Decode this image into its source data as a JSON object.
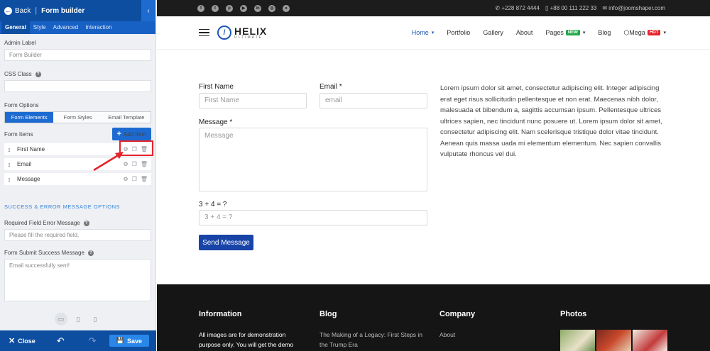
{
  "panel": {
    "back_label": "Back",
    "title": "Form builder",
    "tabs": [
      "General",
      "Style",
      "Advanced",
      "Interaction"
    ],
    "admin_label": {
      "label": "Admin Label",
      "value": "Form Builder"
    },
    "css_class": {
      "label": "CSS Class",
      "value": ""
    },
    "form_options": {
      "label": "Form Options",
      "segments": [
        "Form Elements",
        "Form Styles",
        "Email Template"
      ],
      "active": 0
    },
    "form_items": {
      "label": "Form Items",
      "add_label": "Add Item",
      "items": [
        {
          "label": "First Name"
        },
        {
          "label": "Email"
        },
        {
          "label": "Message"
        }
      ]
    },
    "section_title": "SUCCESS & ERROR MESSAGE OPTIONS",
    "required_error": {
      "label": "Required Field Error Message",
      "value": "Please fill the required field."
    },
    "success_message": {
      "label": "Form Submit Success Message",
      "value": "Email successfully sent!"
    },
    "footer": {
      "close_label": "Close",
      "save_label": "Save"
    },
    "colors": {
      "primary": "#0d4ea0",
      "accent": "#1d6bd1",
      "highlight": "#e5232a"
    }
  },
  "site": {
    "topbar": {
      "socials": [
        "facebook-icon",
        "twitter-icon",
        "pinterest-icon",
        "youtube-icon",
        "linkedin-icon",
        "instagram-icon",
        "flickr-icon"
      ],
      "phone": "+228 872 4444",
      "mobile": "+88 00 111 222 33",
      "email": "info@joomshaper.com"
    },
    "logo": {
      "name": "HELIX",
      "tagline": "ULTIMATE"
    },
    "nav": [
      {
        "label": "Home",
        "active": true,
        "caret": true
      },
      {
        "label": "Portfolio"
      },
      {
        "label": "Gallery"
      },
      {
        "label": "About"
      },
      {
        "label": "Pages",
        "badge": "NEW",
        "caret": true
      },
      {
        "label": "Blog"
      },
      {
        "label": "Mega",
        "badge": "HOT",
        "caret": true
      }
    ],
    "form": {
      "first_name": {
        "label": "First Name",
        "placeholder": "First Name"
      },
      "email": {
        "label": "Email *",
        "placeholder": "email"
      },
      "message": {
        "label": "Message *",
        "placeholder": "Message"
      },
      "captcha": {
        "label": "3 + 4 = ?",
        "placeholder": "3 + 4 = ?"
      },
      "submit": "Send Message"
    },
    "lorem": "Lorem ipsum dolor sit amet, consectetur adipiscing elit. Integer adipiscing erat eget risus sollicitudin pellentesque et non erat. Maecenas nibh dolor, malesuada et bibendum a, sagittis accumsan ipsum. Pellentesque ultrices ultrices sapien, nec tincidunt nunc posuere ut. Lorem ipsum dolor sit amet, consectetur adipiscing elit. Nam scelerisque tristique dolor vitae tincidunt. Aenean quis massa uada mi elementum elementum. Nec sapien convallis vulputate rhoncus vel dui.",
    "footer": {
      "information": {
        "title": "Information",
        "text1": "All images are for demonstration",
        "text2": "purpose only. You will get the demo"
      },
      "blog": {
        "title": "Blog",
        "link1": "The Making of a Legacy: First Steps in",
        "link2": "the Trump Era"
      },
      "company": {
        "title": "Company",
        "link1": "About"
      },
      "photos": {
        "title": "Photos"
      }
    }
  }
}
